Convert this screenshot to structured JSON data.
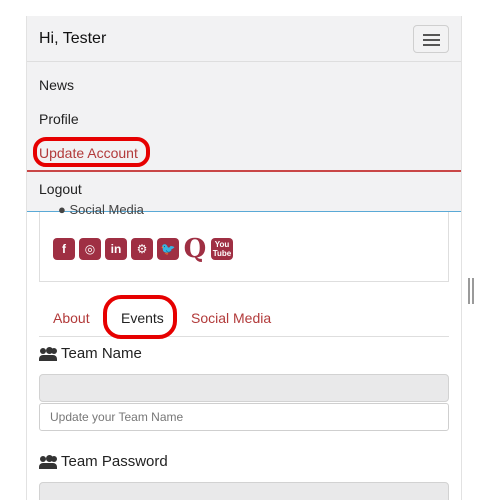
{
  "navbar": {
    "brand": "Hi, Tester",
    "toggler_icon": "hamburger-icon"
  },
  "menu": {
    "items": [
      {
        "label": "News"
      },
      {
        "label": "Profile"
      },
      {
        "label": "Update Account"
      },
      {
        "label": "Logout"
      }
    ]
  },
  "social": {
    "partial_label": "Social Media",
    "icons": [
      {
        "name": "facebook-icon",
        "glyph": "f"
      },
      {
        "name": "instagram-icon",
        "glyph": "◎"
      },
      {
        "name": "linkedin-icon",
        "glyph": "in"
      },
      {
        "name": "steam-icon",
        "glyph": "⚙"
      },
      {
        "name": "twitter-icon",
        "glyph": "🐦"
      },
      {
        "name": "quora-icon",
        "glyph": "Q"
      },
      {
        "name": "youtube-icon",
        "glyph": "You Tube"
      }
    ],
    "accent_color": "#9f2f43"
  },
  "tabs": [
    {
      "label": "About"
    },
    {
      "label": "Events"
    },
    {
      "label": "Social Media"
    }
  ],
  "form": {
    "team_name_label": "Team Name",
    "team_name_placeholder": "Update your Team Name",
    "team_password_label": "Team Password"
  },
  "colors": {
    "link": "#b23a3a",
    "highlight": "#e60000"
  }
}
